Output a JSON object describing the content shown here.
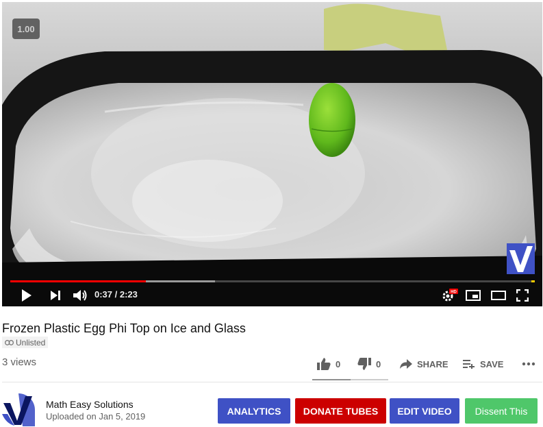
{
  "player": {
    "speed_label": "1.00",
    "time_display": "0:37 / 2:23",
    "progress_fraction": 0.259,
    "buffer_fraction": 0.39,
    "hd_badge": "HD"
  },
  "video": {
    "title": "Frozen Plastic Egg Phi Top on Ice and Glass",
    "visibility": "Unlisted",
    "views": "3 views"
  },
  "actions": {
    "like_count": "0",
    "dislike_count": "0",
    "share_label": "SHARE",
    "save_label": "SAVE",
    "like_ratio": 0.5
  },
  "channel": {
    "name": "Math Easy Solutions",
    "upload_date": "Uploaded on Jan 5, 2019"
  },
  "buttons": {
    "analytics": "ANALYTICS",
    "donate": "DONATE TUBES",
    "edit": "EDIT VIDEO",
    "dissent": "Dissent This"
  },
  "colors": {
    "analytics": "#3f51c5",
    "donate": "#cc0000",
    "edit": "#3f51c5",
    "dissent": "#4fc76a",
    "progress": "#ff0000"
  },
  "icons": [
    "play-icon",
    "next-icon",
    "volume-icon",
    "settings-icon",
    "miniplayer-icon",
    "theater-icon",
    "fullscreen-icon",
    "link-icon",
    "thumbs-up-icon",
    "thumbs-down-icon",
    "share-icon",
    "save-icon",
    "more-icon"
  ]
}
